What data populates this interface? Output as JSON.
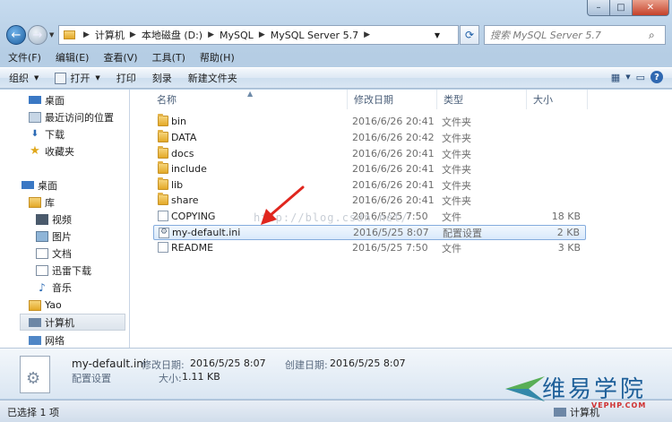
{
  "window": {
    "min": "–",
    "max": "□",
    "close": "✕"
  },
  "address": {
    "crumbs": [
      "计算机",
      "本地磁盘 (D:)",
      "MySQL",
      "MySQL Server 5.7"
    ]
  },
  "search": {
    "placeholder": "搜索 MySQL Server 5.7"
  },
  "menu": [
    "文件(F)",
    "编辑(E)",
    "查看(V)",
    "工具(T)",
    "帮助(H)"
  ],
  "commands": {
    "organize": "组织",
    "open": "打开",
    "print": "打印",
    "burn": "刻录",
    "new_folder": "新建文件夹"
  },
  "nav": {
    "favorites": [
      "桌面",
      "最近访问的位置",
      "下载",
      "收藏夹"
    ],
    "desktop": "桌面",
    "library": "库",
    "libs": [
      "视频",
      "图片",
      "文档",
      "迅雷下载",
      "音乐"
    ],
    "user": "Yao",
    "computer": "计算机",
    "network": "网络"
  },
  "columns": {
    "name": "名称",
    "date": "修改日期",
    "type": "类型",
    "size": "大小"
  },
  "files": [
    {
      "name": "bin",
      "date": "2016/6/26 20:41",
      "type": "文件夹",
      "size": ""
    },
    {
      "name": "DATA",
      "date": "2016/6/26 20:42",
      "type": "文件夹",
      "size": ""
    },
    {
      "name": "docs",
      "date": "2016/6/26 20:41",
      "type": "文件夹",
      "size": ""
    },
    {
      "name": "include",
      "date": "2016/6/26 20:41",
      "type": "文件夹",
      "size": ""
    },
    {
      "name": "lib",
      "date": "2016/6/26 20:41",
      "type": "文件夹",
      "size": ""
    },
    {
      "name": "share",
      "date": "2016/6/26 20:41",
      "type": "文件夹",
      "size": ""
    },
    {
      "name": "COPYING",
      "date": "2016/5/25 7:50",
      "type": "文件",
      "size": "18 KB"
    },
    {
      "name": "my-default.ini",
      "date": "2016/5/25 8:07",
      "type": "配置设置",
      "size": "2 KB"
    },
    {
      "name": "README",
      "date": "2016/5/25 7:50",
      "type": "文件",
      "size": "3 KB"
    }
  ],
  "watermark": "http://blog.csdn.net/",
  "details": {
    "filename": "my-default.ini",
    "modified_label": "修改日期:",
    "modified": "2016/5/25 8:07",
    "created_label": "创建日期:",
    "created": "2016/5/25 8:07",
    "type": "配置设置",
    "size_label": "大小:",
    "size": "1.11 KB"
  },
  "status": {
    "selected": "已选择 1 项",
    "computer": "计算机"
  },
  "logo": {
    "text": "维易学院",
    "sub": "VEPHP.COM"
  }
}
